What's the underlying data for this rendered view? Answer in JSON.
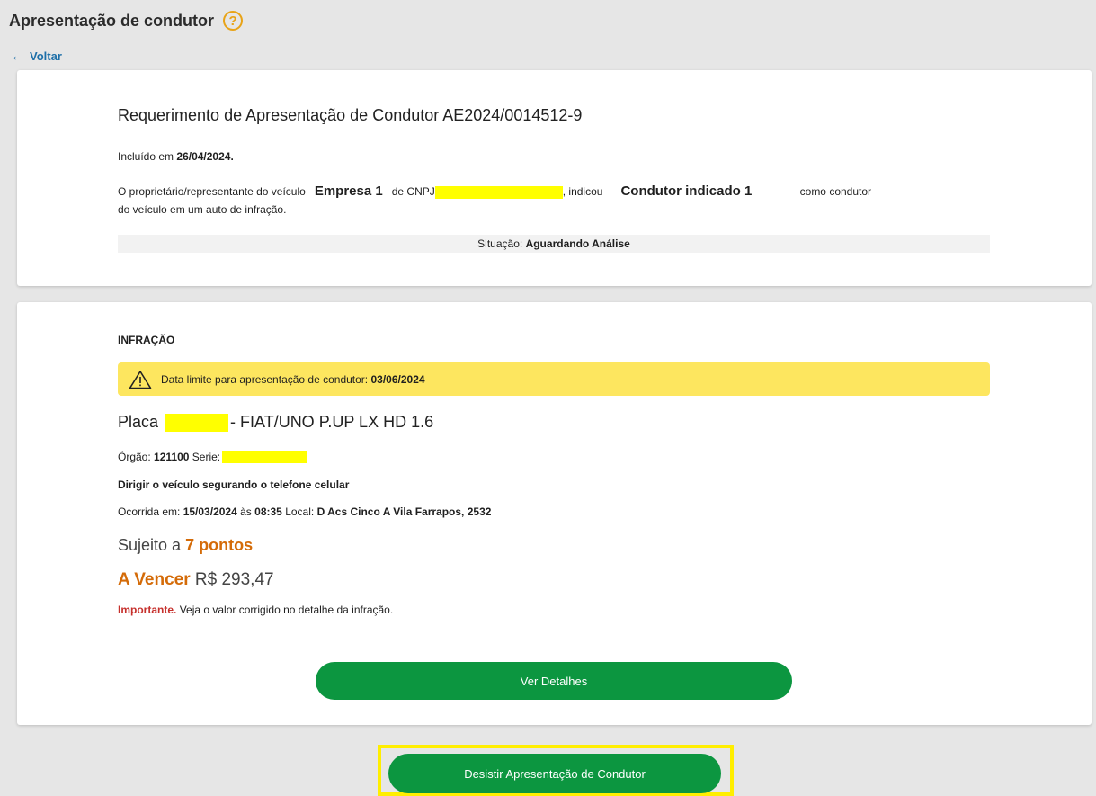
{
  "header": {
    "title": "Apresentação de condutor",
    "help_icon": "?"
  },
  "nav": {
    "back_label": "Voltar"
  },
  "request": {
    "title": "Requerimento de Apresentação de Condutor AE2024/0014512-9",
    "included_prefix": "Incluído em",
    "included_date": "26/04/2024.",
    "owner_text": "O proprietário/representante do veículo",
    "company": "Empresa 1",
    "cnpj_label": "de CNPJ",
    "indicated_text": ", indicou",
    "driver": "Condutor indicado 1",
    "as_driver_text": "como condutor",
    "second_line": "do veículo em um auto de infração.",
    "status_label": "Situação:",
    "status_value": "Aguardando Análise"
  },
  "infraction": {
    "section_title": "INFRAÇÃO",
    "deadline_label": "Data limite para apresentação de condutor:",
    "deadline_date": "03/06/2024",
    "plate_label": "Placa",
    "vehicle": "- FIAT/UNO P.UP LX HD 1.6",
    "orgao_label": "Órgão:",
    "orgao_value": "121100",
    "serie_label": "Serie:",
    "description": "Dirigir o veículo segurando o telefone celular",
    "occurred_label": "Ocorrida em:",
    "occurred_date": "15/03/2024",
    "at_label": "às",
    "occurred_time": "08:35",
    "location_label": "Local:",
    "location": "D Acs Cinco A Vila Farrapos, 2532",
    "points_prefix": "Sujeito a",
    "points_value": "7 pontos",
    "due_label": "A Vencer",
    "amount": "R$ 293,47",
    "important_label": "Importante.",
    "important_text": "Veja o valor corrigido no detalhe da infração."
  },
  "buttons": {
    "details": "Ver Detalhes",
    "desist": "Desistir Apresentação de Condutor"
  },
  "colors": {
    "accent_green": "#0c9640",
    "warning_yellow": "#fde65f",
    "highlight_yellow": "#ffee00",
    "orange": "#d46b08",
    "important_red": "#c6302c",
    "link_blue": "#1d6fa8"
  },
  "icons": {
    "help": "question-circle-icon",
    "back": "arrow-left-icon",
    "warning": "warning-triangle-icon"
  }
}
